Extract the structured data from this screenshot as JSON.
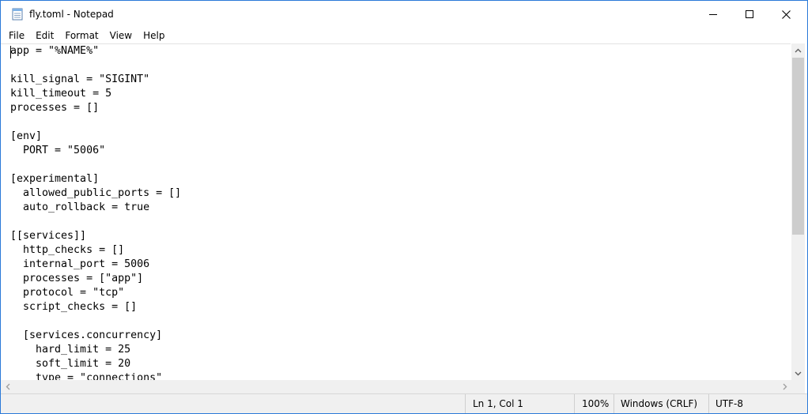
{
  "window": {
    "title": "fly.toml - Notepad"
  },
  "menu": {
    "items": [
      "File",
      "Edit",
      "Format",
      "View",
      "Help"
    ]
  },
  "editor": {
    "lines": [
      "app = \"%NAME%\"",
      "",
      "kill_signal = \"SIGINT\"",
      "kill_timeout = 5",
      "processes = []",
      "",
      "[env]",
      "  PORT = \"5006\"",
      "",
      "[experimental]",
      "  allowed_public_ports = []",
      "  auto_rollback = true",
      "",
      "[[services]]",
      "  http_checks = []",
      "  internal_port = 5006",
      "  processes = [\"app\"]",
      "  protocol = \"tcp\"",
      "  script_checks = []",
      "",
      "  [services.concurrency]",
      "    hard_limit = 25",
      "    soft_limit = 20",
      "    type = \"connections\""
    ]
  },
  "status": {
    "position": "Ln 1, Col 1",
    "zoom": "100%",
    "line_ending": "Windows (CRLF)",
    "encoding": "UTF-8"
  },
  "colors": {
    "border": "#2b79d8",
    "statusbar_bg": "#f0f0f0",
    "scroll_thumb": "#cdcdcd"
  },
  "icons": {
    "app": "notepad-icon",
    "minimize": "minimize-icon",
    "maximize": "maximize-icon",
    "close": "close-icon"
  }
}
